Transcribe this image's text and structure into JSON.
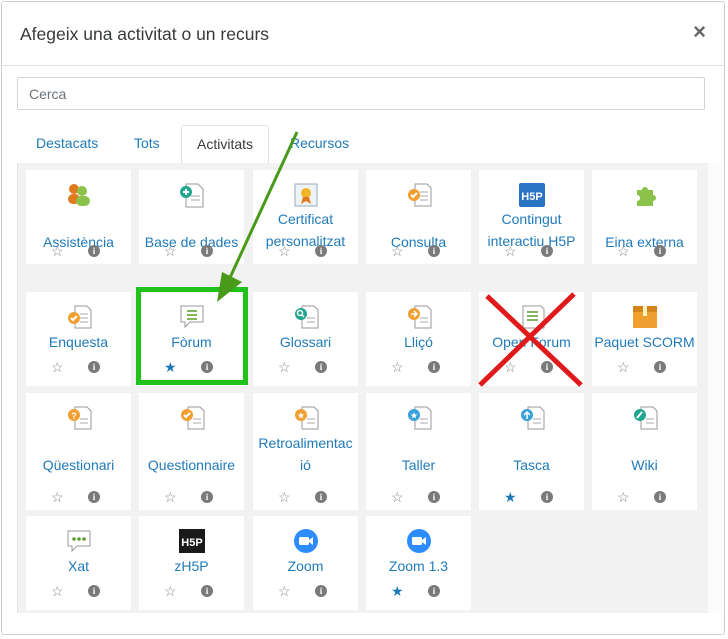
{
  "dialog": {
    "title": "Afegeix una activitat o un recurs",
    "close_glyph": "×"
  },
  "search": {
    "placeholder": "Cerca",
    "value": ""
  },
  "tabs": [
    {
      "label": "Destacats",
      "active": false
    },
    {
      "label": "Tots",
      "active": false
    },
    {
      "label": "Activitats",
      "active": true
    },
    {
      "label": "Recursos",
      "active": false
    }
  ],
  "tiles": [
    {
      "name": "Assistència",
      "icon": "attendance-icon",
      "starred": false
    },
    {
      "name": "Base de dades",
      "icon": "database-icon",
      "starred": false
    },
    {
      "name": "Certificat personalitzat",
      "icon": "certificate-icon",
      "starred": false
    },
    {
      "name": "Consulta",
      "icon": "choice-icon",
      "starred": false
    },
    {
      "name": "Contingut interactiu H5P",
      "icon": "h5p-icon",
      "starred": false
    },
    {
      "name": "Eina externa",
      "icon": "puzzle-icon",
      "starred": false
    },
    {
      "name": "Enquesta",
      "icon": "survey-icon",
      "starred": false
    },
    {
      "name": "Fòrum",
      "icon": "forum-icon",
      "starred": true
    },
    {
      "name": "Glossari",
      "icon": "glossary-icon",
      "starred": false
    },
    {
      "name": "Lliçó",
      "icon": "lesson-icon",
      "starred": false
    },
    {
      "name": "Open Forum",
      "icon": "open-forum-icon",
      "starred": false
    },
    {
      "name": "Paquet SCORM",
      "icon": "scorm-icon",
      "starred": false
    },
    {
      "name": "Qüestionari",
      "icon": "quiz-icon",
      "starred": false
    },
    {
      "name": "Questionnaire",
      "icon": "questionnaire-icon",
      "starred": false
    },
    {
      "name": "Retroalimentació",
      "icon": "feedback-icon",
      "starred": false
    },
    {
      "name": "Taller",
      "icon": "workshop-icon",
      "starred": false
    },
    {
      "name": "Tasca",
      "icon": "assignment-icon",
      "starred": true
    },
    {
      "name": "Wiki",
      "icon": "wiki-icon",
      "starred": false
    },
    {
      "name": "Xat",
      "icon": "chat-icon",
      "starred": false
    },
    {
      "name": "zH5P",
      "icon": "zh5p-icon",
      "starred": false
    },
    {
      "name": "Zoom",
      "icon": "zoom-icon",
      "starred": false
    },
    {
      "name": "Zoom 1.3",
      "icon": "zoom-icon",
      "starred": true
    }
  ],
  "tile_name_lines": {
    "Certificat personalitzat": [
      "Certificat",
      "personalitzat"
    ],
    "Contingut interactiu H5P": [
      "Contingut",
      "interactiu H5P"
    ],
    "Retroalimentació": [
      "Retroalimentac",
      "ió"
    ]
  },
  "star_glyph_empty": "☆",
  "star_glyph_filled": "★",
  "info_glyph": "i",
  "annotations": {
    "highlighted_tile": "Fòrum",
    "crossed_tile": "Open Forum",
    "highlight_color": "#22c21e",
    "arrow_color": "#4a9a1a",
    "cross_color": "#e0191a"
  },
  "colors": {
    "link": "#1f7ab8",
    "background": "#f2f2f2"
  }
}
